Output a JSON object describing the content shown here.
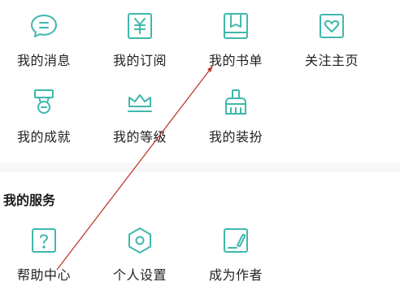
{
  "top_grid": [
    {
      "label": "我的消息",
      "icon": "message-bubble-icon"
    },
    {
      "label": "我的订阅",
      "icon": "yen-subscription-icon"
    },
    {
      "label": "我的书单",
      "icon": "book-list-icon"
    },
    {
      "label": "关注主页",
      "icon": "heart-follow-icon"
    },
    {
      "label": "我的成就",
      "icon": "medal-icon"
    },
    {
      "label": "我的等级",
      "icon": "crown-level-icon"
    },
    {
      "label": "我的装扮",
      "icon": "brush-dress-up-icon"
    }
  ],
  "services": {
    "title": "我的服务",
    "items": [
      {
        "label": "帮助中心",
        "icon": "help-question-icon"
      },
      {
        "label": "个人设置",
        "icon": "settings-hexagon-icon"
      },
      {
        "label": "成为作者",
        "icon": "author-pen-icon"
      }
    ]
  },
  "colors": {
    "icon_teal": "#3fb8ab",
    "text": "#222222",
    "annotation_red": "#c0392b",
    "divider_band": "#f6f7f8"
  }
}
